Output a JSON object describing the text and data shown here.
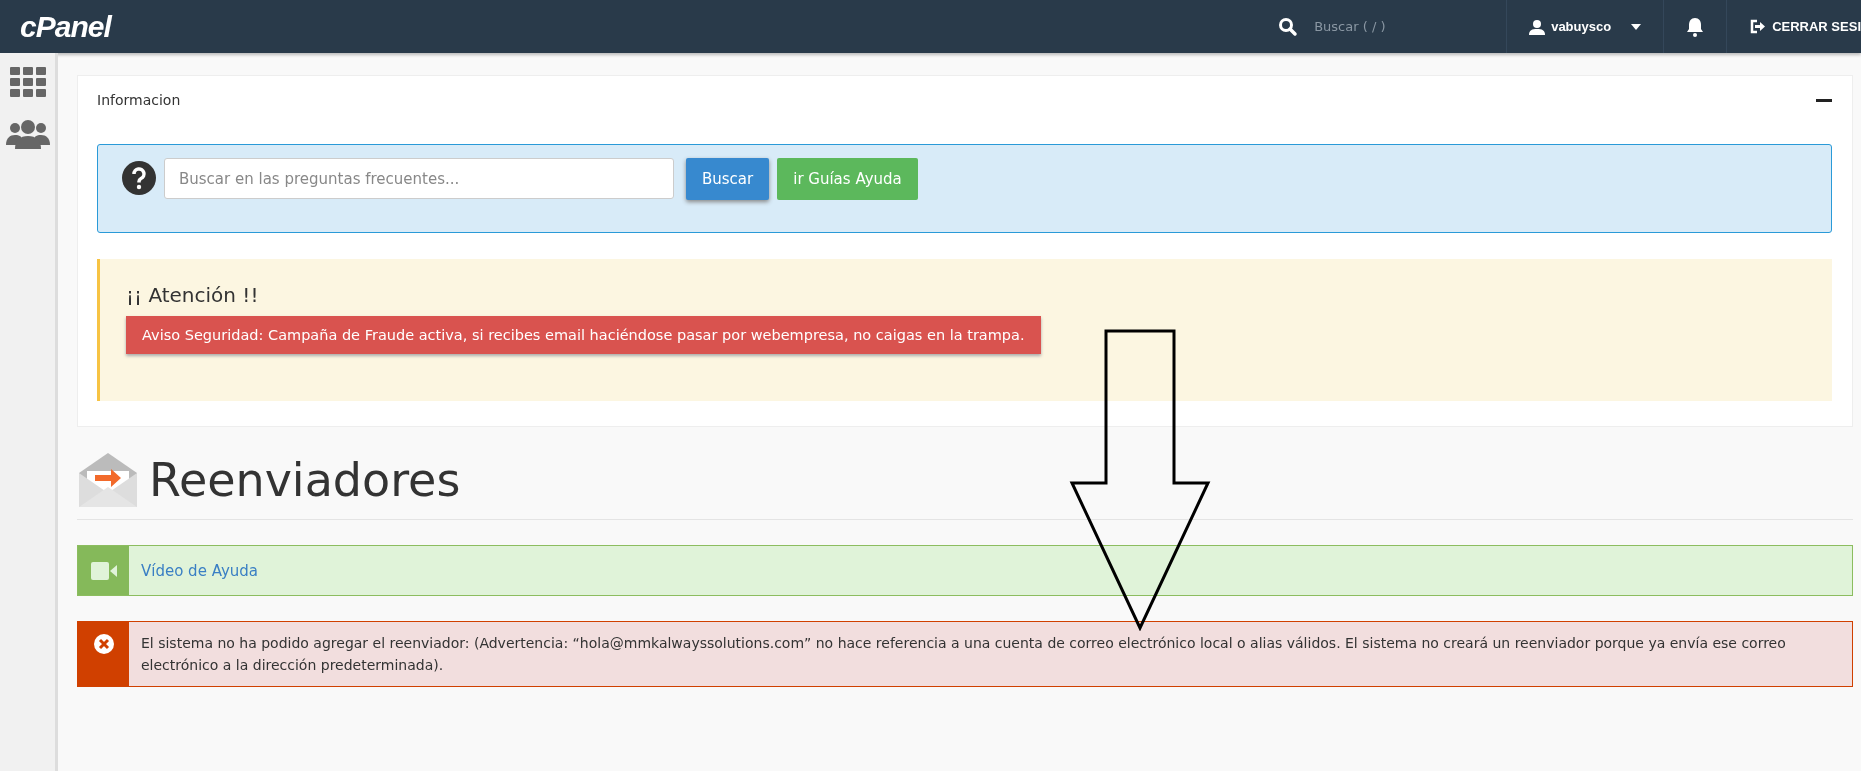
{
  "topbar": {
    "logo": "cPanel",
    "search_placeholder": "Buscar ( / )",
    "user": "vabuysco",
    "logout": "CERRAR SESI"
  },
  "info_panel": {
    "title": "Informacion",
    "faq_placeholder": "Buscar en las preguntas frecuentes...",
    "search_button": "Buscar",
    "guides_button": "ir Guías Ayuda"
  },
  "attention": {
    "title": "¡¡ Atención !!",
    "alert": "Aviso Seguridad: Campaña de Fraude activa, si recibes email haciéndose pasar por webempresa, no caigas en la trampa."
  },
  "page": {
    "title": "Reenviadores",
    "video_link": "Vídeo de Ayuda",
    "error": "El sistema no ha podido agregar el reenviador: (Advertencia: “hola@mmkalwayssolutions.com” no hace referencia a una cuenta de correo electrónico local o alias válidos. El sistema no creará un reenviador porque ya envía ese correo electrónico a la dirección predeterminada)."
  }
}
